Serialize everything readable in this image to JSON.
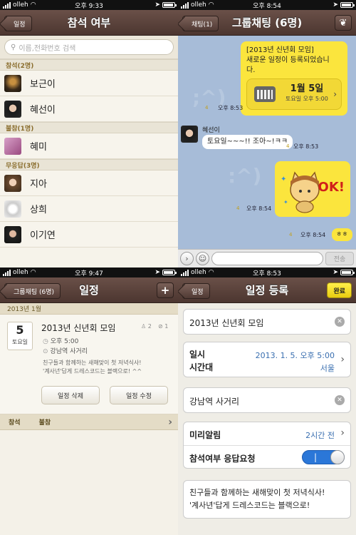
{
  "statusbars": [
    {
      "carrier": "olleh",
      "time": "오후 9:33"
    },
    {
      "carrier": "olleh",
      "time": "오후 8:54"
    },
    {
      "carrier": "olleh",
      "time": "오후 9:47"
    },
    {
      "carrier": "olleh",
      "time": "오후 8:53"
    }
  ],
  "attendance": {
    "back_label": "일정",
    "title": "참석 여부",
    "search_placeholder": "이름,전화번호 검색",
    "sections": [
      {
        "header": "참석(2명)",
        "people": [
          "보근이",
          "혜선이"
        ]
      },
      {
        "header": "불참(1명)",
        "people": [
          "혜미"
        ]
      },
      {
        "header": "무응답(3명)",
        "people": [
          "지아",
          "상희",
          "이기연"
        ]
      }
    ]
  },
  "chat": {
    "back_label": "채팅(1)",
    "title": "그룹채팅 (6명)",
    "msg1_line1": "[2013년 신년회 모임]",
    "msg1_line2": "새로운 일정이 등록되었습니",
    "msg1_line3": "다.",
    "event_date": "1월 5일",
    "event_sub": "토요일 오후 5:00",
    "msg1_count": "4",
    "msg1_time": "오후 8:53",
    "sender": "혜선이",
    "msg2_text": "토요일~~~!! 조아~!ㅋㅋ",
    "msg2_count": "4",
    "msg2_time": "오후 8:53",
    "sticker_text": "OK!",
    "msg3_count": "4",
    "msg3_time": "오후 8:54",
    "msg4_text": "ㅎㅎ",
    "msg4_count": "4",
    "msg4_time": "오후 8:54",
    "send_label": "전송"
  },
  "schedule": {
    "back_label": "그룹채팅 (6명)",
    "title": "일정",
    "add_label": "+",
    "month": "2013년 1월",
    "day": "5",
    "weekday": "토요일",
    "event_title": "2013년 신년회 모임",
    "event_time": "오후 5:00",
    "event_place": "강남역 사거리",
    "attend_count": "2",
    "absent_count": "1",
    "desc_line1": "친구들과 함께하는 새해맞이 첫 저녁식사!",
    "desc_line2": "'계사년'답게 드레스코드는 블랙으로! ^^",
    "delete_label": "일정 삭제",
    "edit_label": "일정 수정",
    "tab_attend": "참석",
    "tab_absent": "불참"
  },
  "register": {
    "back_label": "일정",
    "title": "일정 등록",
    "done_label": "완료",
    "name_value": "2013년 신년회 모임",
    "datetime_label_1": "일시",
    "datetime_label_2": "시간대",
    "datetime_value": "2013. 1. 5. 오후 5:00",
    "timezone_value": "서울",
    "place_value": "강남역 사거리",
    "reminder_label": "미리알림",
    "reminder_value": "2시간 전",
    "rsvp_label": "참석여부 응답요청",
    "rsvp_on": true,
    "memo_line1": "친구들과 함께하는 새해맞이 첫 저녁식사!",
    "memo_line2": "'계사년'답게 드레스코드는 블랙으로!"
  },
  "colors": {
    "nav_brown": "#5a4038",
    "chat_bg": "#9bb2cf",
    "kakao_yellow": "#fbe53d",
    "toggle_blue": "#2b77d8"
  }
}
